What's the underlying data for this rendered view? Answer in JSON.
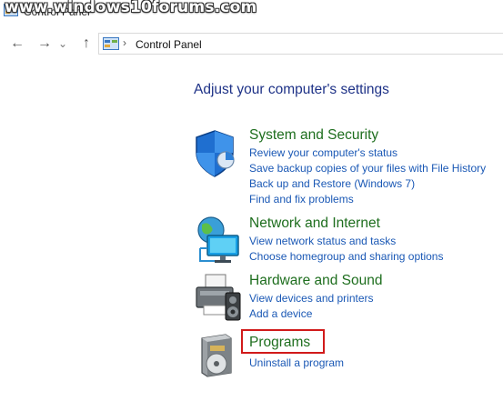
{
  "window": {
    "title": "Control Panel",
    "watermark": "www.windows10forums.com"
  },
  "nav": {
    "back_glyph": "←",
    "forward_glyph": "→",
    "recent_glyph": "⌄",
    "up_glyph": "↑"
  },
  "address": {
    "separator": "›",
    "location": "Control Panel"
  },
  "main": {
    "heading": "Adjust your computer's settings",
    "categories": [
      {
        "title": "System and Security",
        "icon": "shield-icon",
        "links": [
          "Review your computer's status",
          "Save backup copies of your files with File History",
          "Back up and Restore (Windows 7)",
          "Find and fix problems"
        ]
      },
      {
        "title": "Network and Internet",
        "icon": "network-globe-icon",
        "links": [
          "View network status and tasks",
          "Choose homegroup and sharing options"
        ]
      },
      {
        "title": "Hardware and Sound",
        "icon": "printer-speaker-icon",
        "links": [
          "View devices and printers",
          "Add a device"
        ]
      },
      {
        "title": "Programs",
        "icon": "programs-disc-icon",
        "links": [
          "Uninstall a program"
        ]
      }
    ]
  },
  "colors": {
    "heading": "#1e3287",
    "category_title": "#1e6e1e",
    "link": "#1a58b5",
    "highlight": "#d11a1a"
  }
}
